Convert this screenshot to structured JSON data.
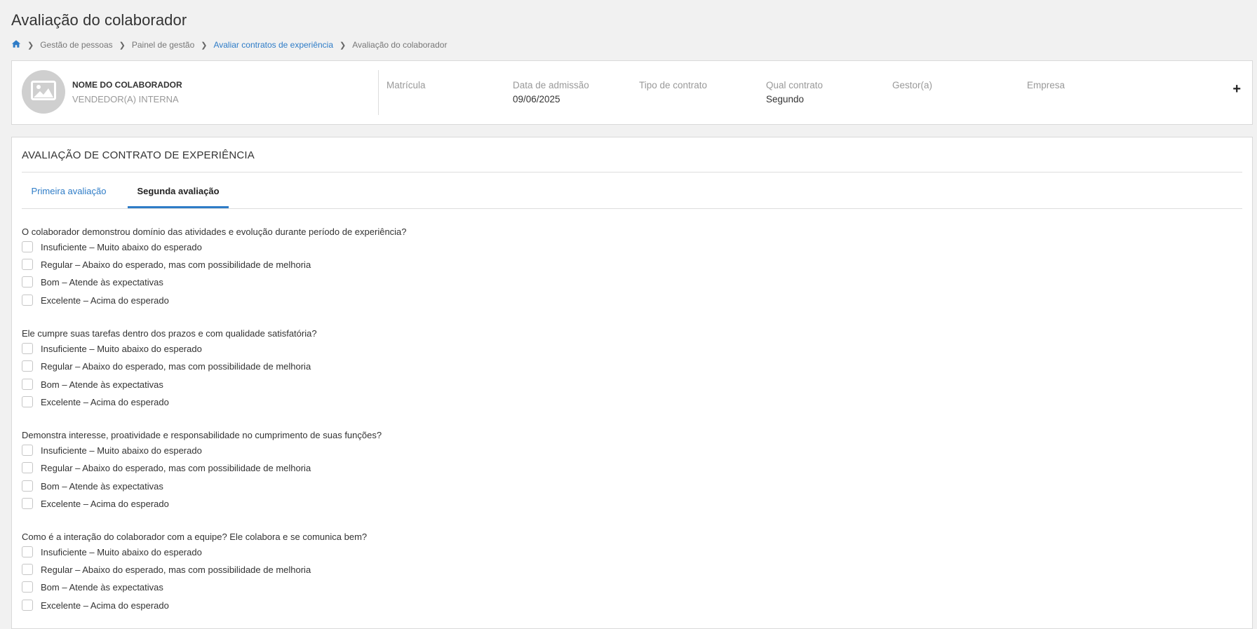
{
  "page": {
    "title": "Avaliação do colaborador",
    "breadcrumb": [
      {
        "label": "Gestão de pessoas"
      },
      {
        "label": "Painel de gestão"
      },
      {
        "label": "Avaliar contratos de experiência"
      },
      {
        "label": "Avaliação do colaborador"
      }
    ]
  },
  "employee": {
    "name": "NOME DO COLABORADOR",
    "role": "VENDEDOR(A) INTERNA",
    "fields": [
      {
        "label": "Matrícula",
        "value": ""
      },
      {
        "label": "Data de admissão",
        "value": "09/06/2025"
      },
      {
        "label": "Tipo de contrato",
        "value": ""
      },
      {
        "label": "Qual contrato",
        "value": "Segundo"
      },
      {
        "label": "Gestor(a)",
        "value": ""
      },
      {
        "label": "Empresa",
        "value": ""
      }
    ],
    "expand_label": "+"
  },
  "evaluation": {
    "title": "AVALIAÇÃO DE CONTRATO DE EXPERIÊNCIA",
    "tabs": [
      {
        "label": "Primeira avaliação",
        "active": false
      },
      {
        "label": "Segunda avaliação",
        "active": true
      }
    ],
    "questions": [
      {
        "text": "O colaborador demonstrou domínio das atividades e evolução durante período de experiência?",
        "options": [
          "Insuficiente – Muito abaixo do esperado",
          "Regular – Abaixo do esperado, mas com possibilidade de melhoria",
          "Bom – Atende às expectativas",
          "Excelente – Acima do esperado"
        ]
      },
      {
        "text": "Ele cumpre suas tarefas dentro dos prazos e com qualidade satisfatória?",
        "options": [
          "Insuficiente – Muito abaixo do esperado",
          "Regular – Abaixo do esperado, mas com possibilidade de melhoria",
          "Bom – Atende às expectativas",
          "Excelente – Acima do esperado"
        ]
      },
      {
        "text": "Demonstra interesse, proatividade e responsabilidade no cumprimento de suas funções?",
        "options": [
          "Insuficiente – Muito abaixo do esperado",
          "Regular – Abaixo do esperado, mas com possibilidade de melhoria",
          "Bom – Atende às expectativas",
          "Excelente – Acima do esperado"
        ]
      },
      {
        "text": "Como é a interação do colaborador com a equipe? Ele colabora e se comunica bem?",
        "options": [
          "Insuficiente – Muito abaixo do esperado",
          "Regular – Abaixo do esperado, mas com possibilidade de melhoria",
          "Bom – Atende às expectativas",
          "Excelente – Acima do esperado"
        ]
      }
    ]
  },
  "icons": {
    "home": "home-icon",
    "avatar": "image-placeholder-icon",
    "separator": "chevron-right-icon"
  },
  "colors": {
    "accent": "#2e7cc7",
    "background": "#f1f1f1",
    "card": "#ffffff"
  }
}
